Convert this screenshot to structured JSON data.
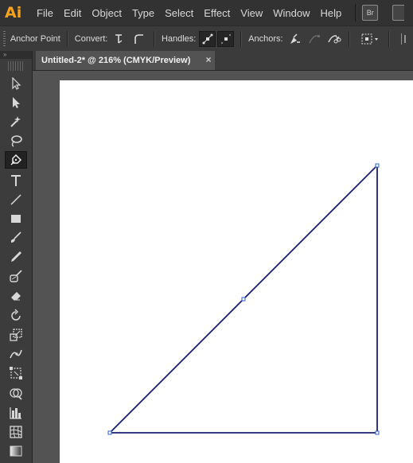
{
  "app": {
    "logo_text": "Ai"
  },
  "menu": [
    "File",
    "Edit",
    "Object",
    "Type",
    "Select",
    "Effect",
    "View",
    "Window",
    "Help"
  ],
  "bridge": {
    "label": "Br"
  },
  "control_bar": {
    "title": "Anchor Point",
    "convert_label": "Convert:",
    "handles_label": "Handles:",
    "anchors_label": "Anchors:"
  },
  "document_tab": {
    "title": "Untitled-2* @ 216% (CMYK/Preview)",
    "close": "×"
  },
  "toolbar": {
    "collapse_glyph": "»",
    "active_tool": "pen-tool",
    "tools": [
      "selection-tool",
      "direct-selection-tool",
      "magic-wand-tool",
      "lasso-tool",
      "pen-tool",
      "type-tool",
      "line-segment-tool",
      "rectangle-tool",
      "paintbrush-tool",
      "pencil-tool",
      "blob-brush-tool",
      "eraser-tool",
      "rotate-tool",
      "scale-tool",
      "width-tool",
      "free-transform-tool",
      "shape-builder-tool",
      "graph-tool",
      "mesh-tool",
      "gradient-tool"
    ]
  },
  "artwork": {
    "shape": "right-triangle",
    "stroke_color": "#1a1f6e",
    "anchor_color": "#2f5fd0"
  }
}
